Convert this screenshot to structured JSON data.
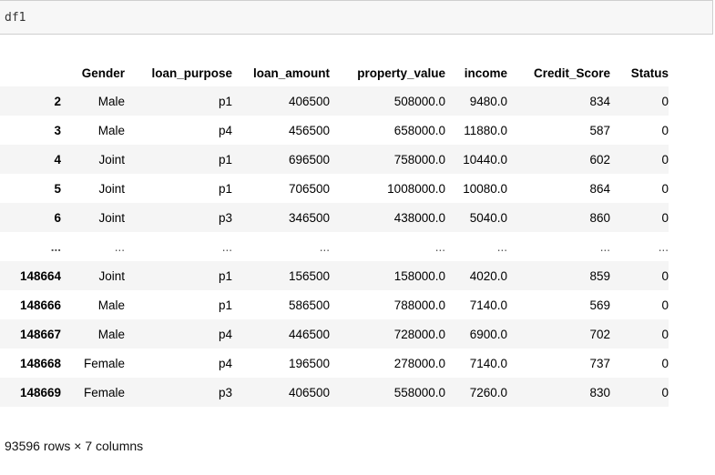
{
  "cell": {
    "code": "df1"
  },
  "table": {
    "columns": [
      "",
      "Gender",
      "loan_purpose",
      "loan_amount",
      "property_value",
      "income",
      "Credit_Score",
      "Status"
    ],
    "rows": [
      [
        "2",
        "Male",
        "p1",
        "406500",
        "508000.0",
        "9480.0",
        "834",
        "0"
      ],
      [
        "3",
        "Male",
        "p4",
        "456500",
        "658000.0",
        "11880.0",
        "587",
        "0"
      ],
      [
        "4",
        "Joint",
        "p1",
        "696500",
        "758000.0",
        "10440.0",
        "602",
        "0"
      ],
      [
        "5",
        "Joint",
        "p1",
        "706500",
        "1008000.0",
        "10080.0",
        "864",
        "0"
      ],
      [
        "6",
        "Joint",
        "p3",
        "346500",
        "438000.0",
        "5040.0",
        "860",
        "0"
      ],
      [
        "...",
        "...",
        "...",
        "...",
        "...",
        "...",
        "...",
        "..."
      ],
      [
        "148664",
        "Joint",
        "p1",
        "156500",
        "158000.0",
        "4020.0",
        "859",
        "0"
      ],
      [
        "148666",
        "Male",
        "p1",
        "586500",
        "788000.0",
        "7140.0",
        "569",
        "0"
      ],
      [
        "148667",
        "Male",
        "p4",
        "446500",
        "728000.0",
        "6900.0",
        "702",
        "0"
      ],
      [
        "148668",
        "Female",
        "p4",
        "196500",
        "278000.0",
        "7140.0",
        "737",
        "0"
      ],
      [
        "148669",
        "Female",
        "p3",
        "406500",
        "558000.0",
        "7260.0",
        "830",
        "0"
      ]
    ]
  },
  "footer": {
    "summary": "93596 rows × 7 columns"
  }
}
